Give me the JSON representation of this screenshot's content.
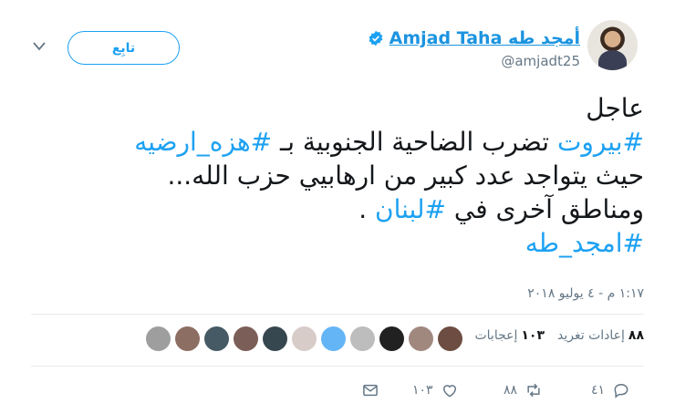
{
  "header": {
    "display_name": "Amjad Taha أمجد طه",
    "handle": "@amjadt25",
    "follow_label": "تابِع",
    "avatar_icon": "profile-photo"
  },
  "tweet": {
    "lines": [
      [
        {
          "text": "عاجل",
          "tag": false
        }
      ],
      [
        {
          "text": "#بيروت",
          "tag": true
        },
        {
          "text": " تضرب الضاحية الجنوبية بـ ",
          "tag": false
        },
        {
          "text": "#هزه_ارضيه",
          "tag": true
        }
      ],
      [
        {
          "text": "حيث يتواجد عدد كبير من ارهابيي حزب الله...",
          "tag": false
        }
      ],
      [
        {
          "text": "ومناطق آخرى في ",
          "tag": false
        },
        {
          "text": "#لبنان",
          "tag": true
        },
        {
          "text": " .",
          "tag": false
        }
      ],
      [
        {
          "text": "#امجد_طه",
          "tag": true
        }
      ]
    ],
    "timestamp": "١:١٧ م - ٤ يوليو ٢٠١٨"
  },
  "stats": {
    "retweets_count": "٨٨",
    "retweets_label": "إعادات تغريد",
    "likes_count": "١٠٣",
    "likes_label": "إعجابات"
  },
  "likers": [
    {
      "icon": "avatar-1",
      "color": "#6d4c41"
    },
    {
      "icon": "avatar-2",
      "color": "#a1887f"
    },
    {
      "icon": "avatar-3",
      "color": "#212121"
    },
    {
      "icon": "avatar-4",
      "color": "#bdbdbd"
    },
    {
      "icon": "avatar-5",
      "color": "#64b5f6"
    },
    {
      "icon": "avatar-6",
      "color": "#d7ccc8"
    },
    {
      "icon": "avatar-7",
      "color": "#37474f"
    },
    {
      "icon": "avatar-8",
      "color": "#7b5e57"
    },
    {
      "icon": "avatar-9",
      "color": "#455a64"
    },
    {
      "icon": "avatar-10",
      "color": "#8d6e63"
    },
    {
      "icon": "avatar-default",
      "color": "#9e9e9e"
    }
  ],
  "actions": {
    "reply_count": "٤١",
    "retweet_count": "٨٨",
    "like_count": "١٠٣"
  },
  "colors": {
    "accent": "#1da1f2",
    "link": "#1c94e0",
    "muted": "#657786"
  }
}
